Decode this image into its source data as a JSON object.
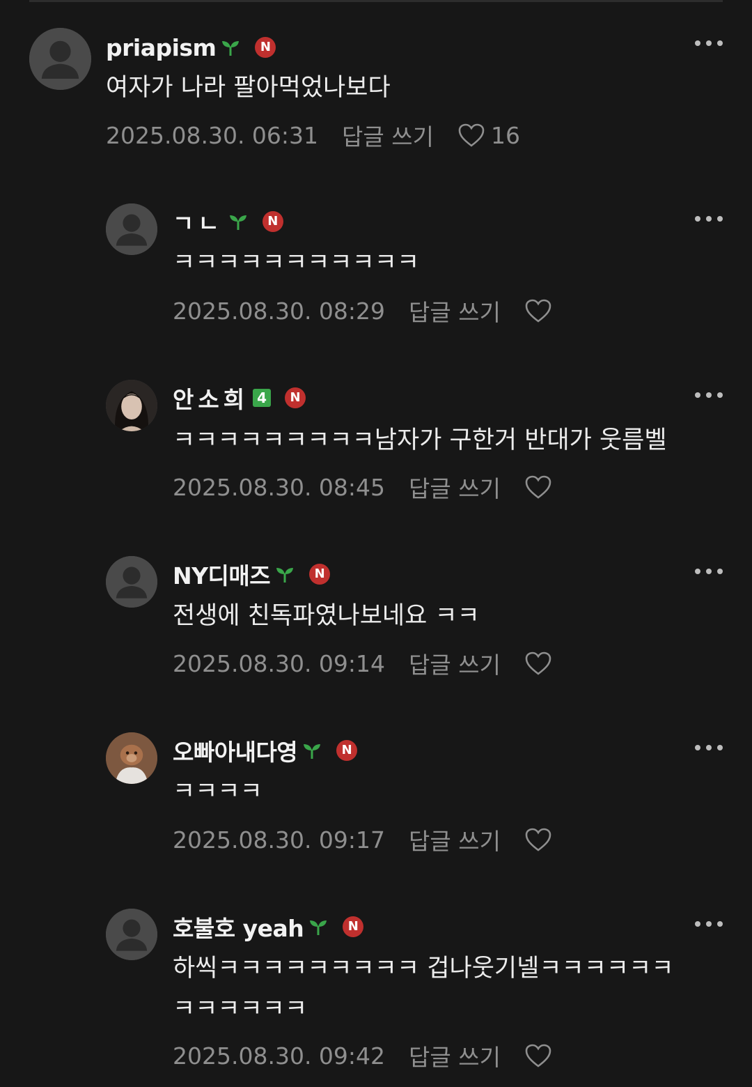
{
  "comments": [
    {
      "author": "priapism",
      "avatar": "default-avatar",
      "badge": "sprout-icon",
      "n_badge": "N",
      "text_lines": [
        "여자가 나라 팔아먹었나보다"
      ],
      "timestamp": "2025.08.30. 06:31",
      "reply_label": "답글 쓰기",
      "like_count": "16"
    },
    {
      "author": "ㄱㄴ",
      "avatar": "default-avatar",
      "badge": "sprout-icon",
      "n_badge": "N",
      "text_lines": [
        "ㅋㅋㅋㅋㅋㅋㅋㅋㅋㅋㅋ"
      ],
      "timestamp": "2025.08.30. 08:29",
      "reply_label": "답글 쓰기",
      "like_count": ""
    },
    {
      "author": "안소희",
      "avatar": "photo-avatar",
      "badge": "4",
      "n_badge": "N",
      "text_lines": [
        "ㅋㅋㅋㅋㅋㅋㅋㅋㅋ남자가 구한거 반대가 웃름벨"
      ],
      "timestamp": "2025.08.30. 08:45",
      "reply_label": "답글 쓰기",
      "like_count": ""
    },
    {
      "author": "NY디매즈",
      "avatar": "default-avatar",
      "badge": "sprout-icon",
      "n_badge": "N",
      "text_lines": [
        "전생에 친독파였나보네요 ㅋㅋ"
      ],
      "timestamp": "2025.08.30. 09:14",
      "reply_label": "답글 쓰기",
      "like_count": ""
    },
    {
      "author": "오빠아내다영",
      "avatar": "photo-avatar",
      "badge": "sprout-icon",
      "n_badge": "N",
      "text_lines": [
        "ㅋㅋㅋㅋ"
      ],
      "timestamp": "2025.08.30. 09:17",
      "reply_label": "답글 쓰기",
      "like_count": ""
    },
    {
      "author": "호불호 yeah",
      "avatar": "default-avatar",
      "badge": "sprout-icon",
      "n_badge": "N",
      "text_lines": [
        "하씩ㅋㅋㅋㅋㅋㅋㅋㅋㅋ 겁나웃기넬ㅋㅋㅋㅋㅋㅋ",
        "ㅋㅋㅋㅋㅋㅋ"
      ],
      "timestamp": "2025.08.30. 09:42",
      "reply_label": "답글 쓰기",
      "like_count": ""
    }
  ],
  "colors": {
    "background": "#171717",
    "text": "#ececec",
    "meta": "#8f8f8f",
    "n_badge": "#c0302e",
    "sprout": "#3aa64a"
  }
}
